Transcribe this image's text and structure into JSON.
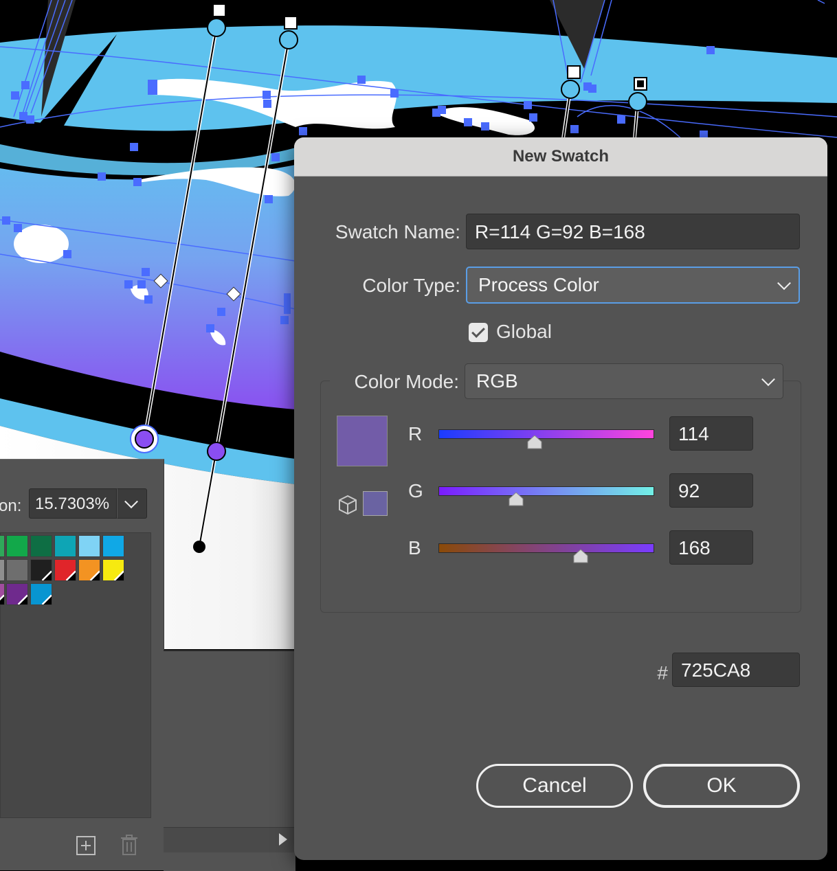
{
  "dialog": {
    "title": "New Swatch",
    "swatch_name_label": "Swatch Name:",
    "swatch_name_value": "R=114 G=92 B=168",
    "color_type_label": "Color Type:",
    "color_type_value": "Process Color",
    "global_label": "Global",
    "global_checked": true,
    "color_mode_label": "Color Mode:",
    "color_mode_value": "RGB",
    "preview_color": "#725CA8",
    "channels": [
      {
        "label": "R",
        "value": "114",
        "level": 0.447,
        "gradient": [
          "#1a3cff",
          "#ff44dd"
        ]
      },
      {
        "label": "G",
        "value": "92",
        "level": 0.361,
        "gradient": [
          "#7a1cff",
          "#72f0e6"
        ]
      },
      {
        "label": "B",
        "value": "168",
        "level": 0.659,
        "gradient": [
          "#8a4a08",
          "#7a3cff"
        ]
      }
    ],
    "hex_label": "#",
    "hex_value": "725CA8",
    "cancel_label": "Cancel",
    "ok_label": "OK"
  },
  "swatches_panel": {
    "angle_label": "on:",
    "angle_value": "15.7303%",
    "swatches": [
      "#2fa85a",
      "#12a84a",
      "#0e6e44",
      "#0ea5b5",
      "#7fd3f5",
      "#10a8e6",
      "#8f8f8f",
      "#6e6e6e",
      "#1f1f1f",
      "#e0252a",
      "#f39322",
      "#f6ea10",
      "#a14d9e",
      "#6f2a8d",
      "#0895d1"
    ]
  },
  "artboard": {
    "fill_colors": {
      "sky_blue": "#5cbdef",
      "violet": "#8a5cf2",
      "black": "#000000",
      "white": "#ffffff",
      "handle_blue": "#4a6cff"
    }
  }
}
